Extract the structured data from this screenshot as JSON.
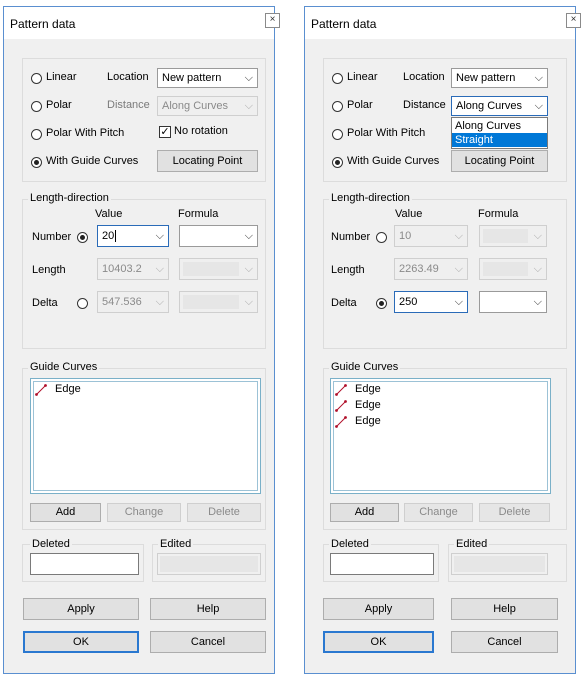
{
  "dialogs": [
    {
      "title": "Pattern data",
      "close_symbol": "×",
      "pattern_types": [
        {
          "label": "Linear",
          "selected": false
        },
        {
          "label": "Polar",
          "selected": false
        },
        {
          "label": "Polar With Pitch",
          "selected": false
        },
        {
          "label": "With Guide Curves",
          "selected": true
        }
      ],
      "location_label": "Location",
      "location_value": "New pattern",
      "distance_label": "Distance",
      "distance_value": "Along Curves",
      "distance_enabled": false,
      "no_rotation_label": "No rotation",
      "no_rotation_checked": true,
      "locating_point_label": "Locating Point",
      "length_direction": {
        "title": "Length-direction",
        "value_header": "Value",
        "formula_header": "Formula",
        "rows": [
          {
            "label": "Number",
            "value": "20",
            "selected": true
          },
          {
            "label": "Length",
            "value": "10403.2",
            "selected": null
          },
          {
            "label": "Delta",
            "value": "547.536",
            "selected": false
          }
        ]
      },
      "guide_curves": {
        "title": "Guide Curves",
        "items": [
          "Edge"
        ],
        "add_label": "Add",
        "change_label": "Change",
        "delete_label": "Delete"
      },
      "deleted_label": "Deleted",
      "edited_label": "Edited",
      "apply_label": "Apply",
      "help_label": "Help",
      "ok_label": "OK",
      "cancel_label": "Cancel"
    },
    {
      "title": "Pattern data",
      "close_symbol": "×",
      "pattern_types": [
        {
          "label": "Linear",
          "selected": false
        },
        {
          "label": "Polar",
          "selected": false
        },
        {
          "label": "Polar With Pitch",
          "selected": false
        },
        {
          "label": "With Guide Curves",
          "selected": true
        }
      ],
      "location_label": "Location",
      "location_value": "New pattern",
      "distance_label": "Distance",
      "distance_value": "Along Curves",
      "distance_enabled": true,
      "distance_options": [
        "Along Curves",
        "Straight"
      ],
      "distance_highlighted": "Straight",
      "locating_point_label": "Locating Point",
      "length_direction": {
        "title": "Length-direction",
        "value_header": "Value",
        "formula_header": "Formula",
        "rows": [
          {
            "label": "Number",
            "value": "10",
            "selected": false
          },
          {
            "label": "Length",
            "value": "2263.49",
            "selected": null
          },
          {
            "label": "Delta",
            "value": "250",
            "selected": true
          }
        ]
      },
      "guide_curves": {
        "title": "Guide Curves",
        "items": [
          "Edge",
          "Edge",
          "Edge"
        ],
        "add_label": "Add",
        "change_label": "Change",
        "delete_label": "Delete"
      },
      "deleted_label": "Deleted",
      "edited_label": "Edited",
      "apply_label": "Apply",
      "help_label": "Help",
      "ok_label": "OK",
      "cancel_label": "Cancel"
    }
  ],
  "colors": {
    "window_border": "#5a8fd0",
    "accent": "#0078d7",
    "edge_icon": "#b0102a"
  },
  "icons": {
    "combo_arrow": "⌵",
    "checkmark": "✓",
    "edge": "edge-curve-icon"
  }
}
